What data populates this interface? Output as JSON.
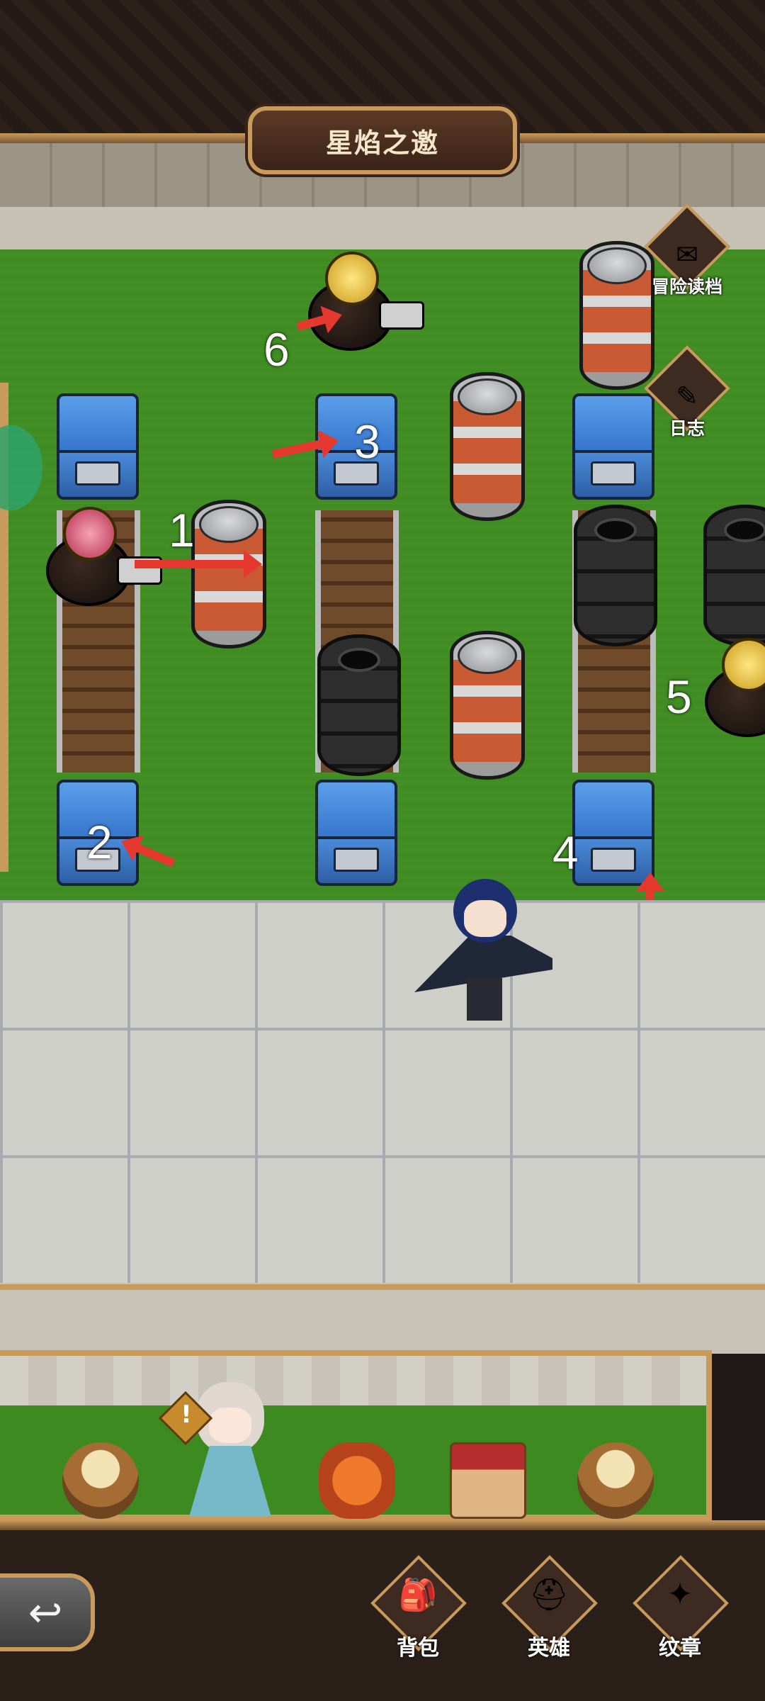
{
  "header": {
    "title": "星焰之邀"
  },
  "side_buttons": [
    {
      "label": "冒险读档",
      "icon": "envelope-feather-icon"
    },
    {
      "label": "日志",
      "icon": "scroll-quill-icon"
    }
  ],
  "annotations": [
    "1",
    "2",
    "3",
    "4",
    "5",
    "6"
  ],
  "npc": {
    "alert_icon": "!"
  },
  "bottom_nav": {
    "back_icon": "back-arrow-icon",
    "items": [
      {
        "label": "背包",
        "icon": "backpack-icon"
      },
      {
        "label": "英雄",
        "icon": "helmet-icon"
      },
      {
        "label": "纹章",
        "icon": "emblem-icon"
      }
    ]
  },
  "colors": {
    "grass": "#3f8d22",
    "crate_blue": "#3474cc",
    "arrow_red": "#e5382f",
    "frame_gold": "#c89a5b"
  }
}
